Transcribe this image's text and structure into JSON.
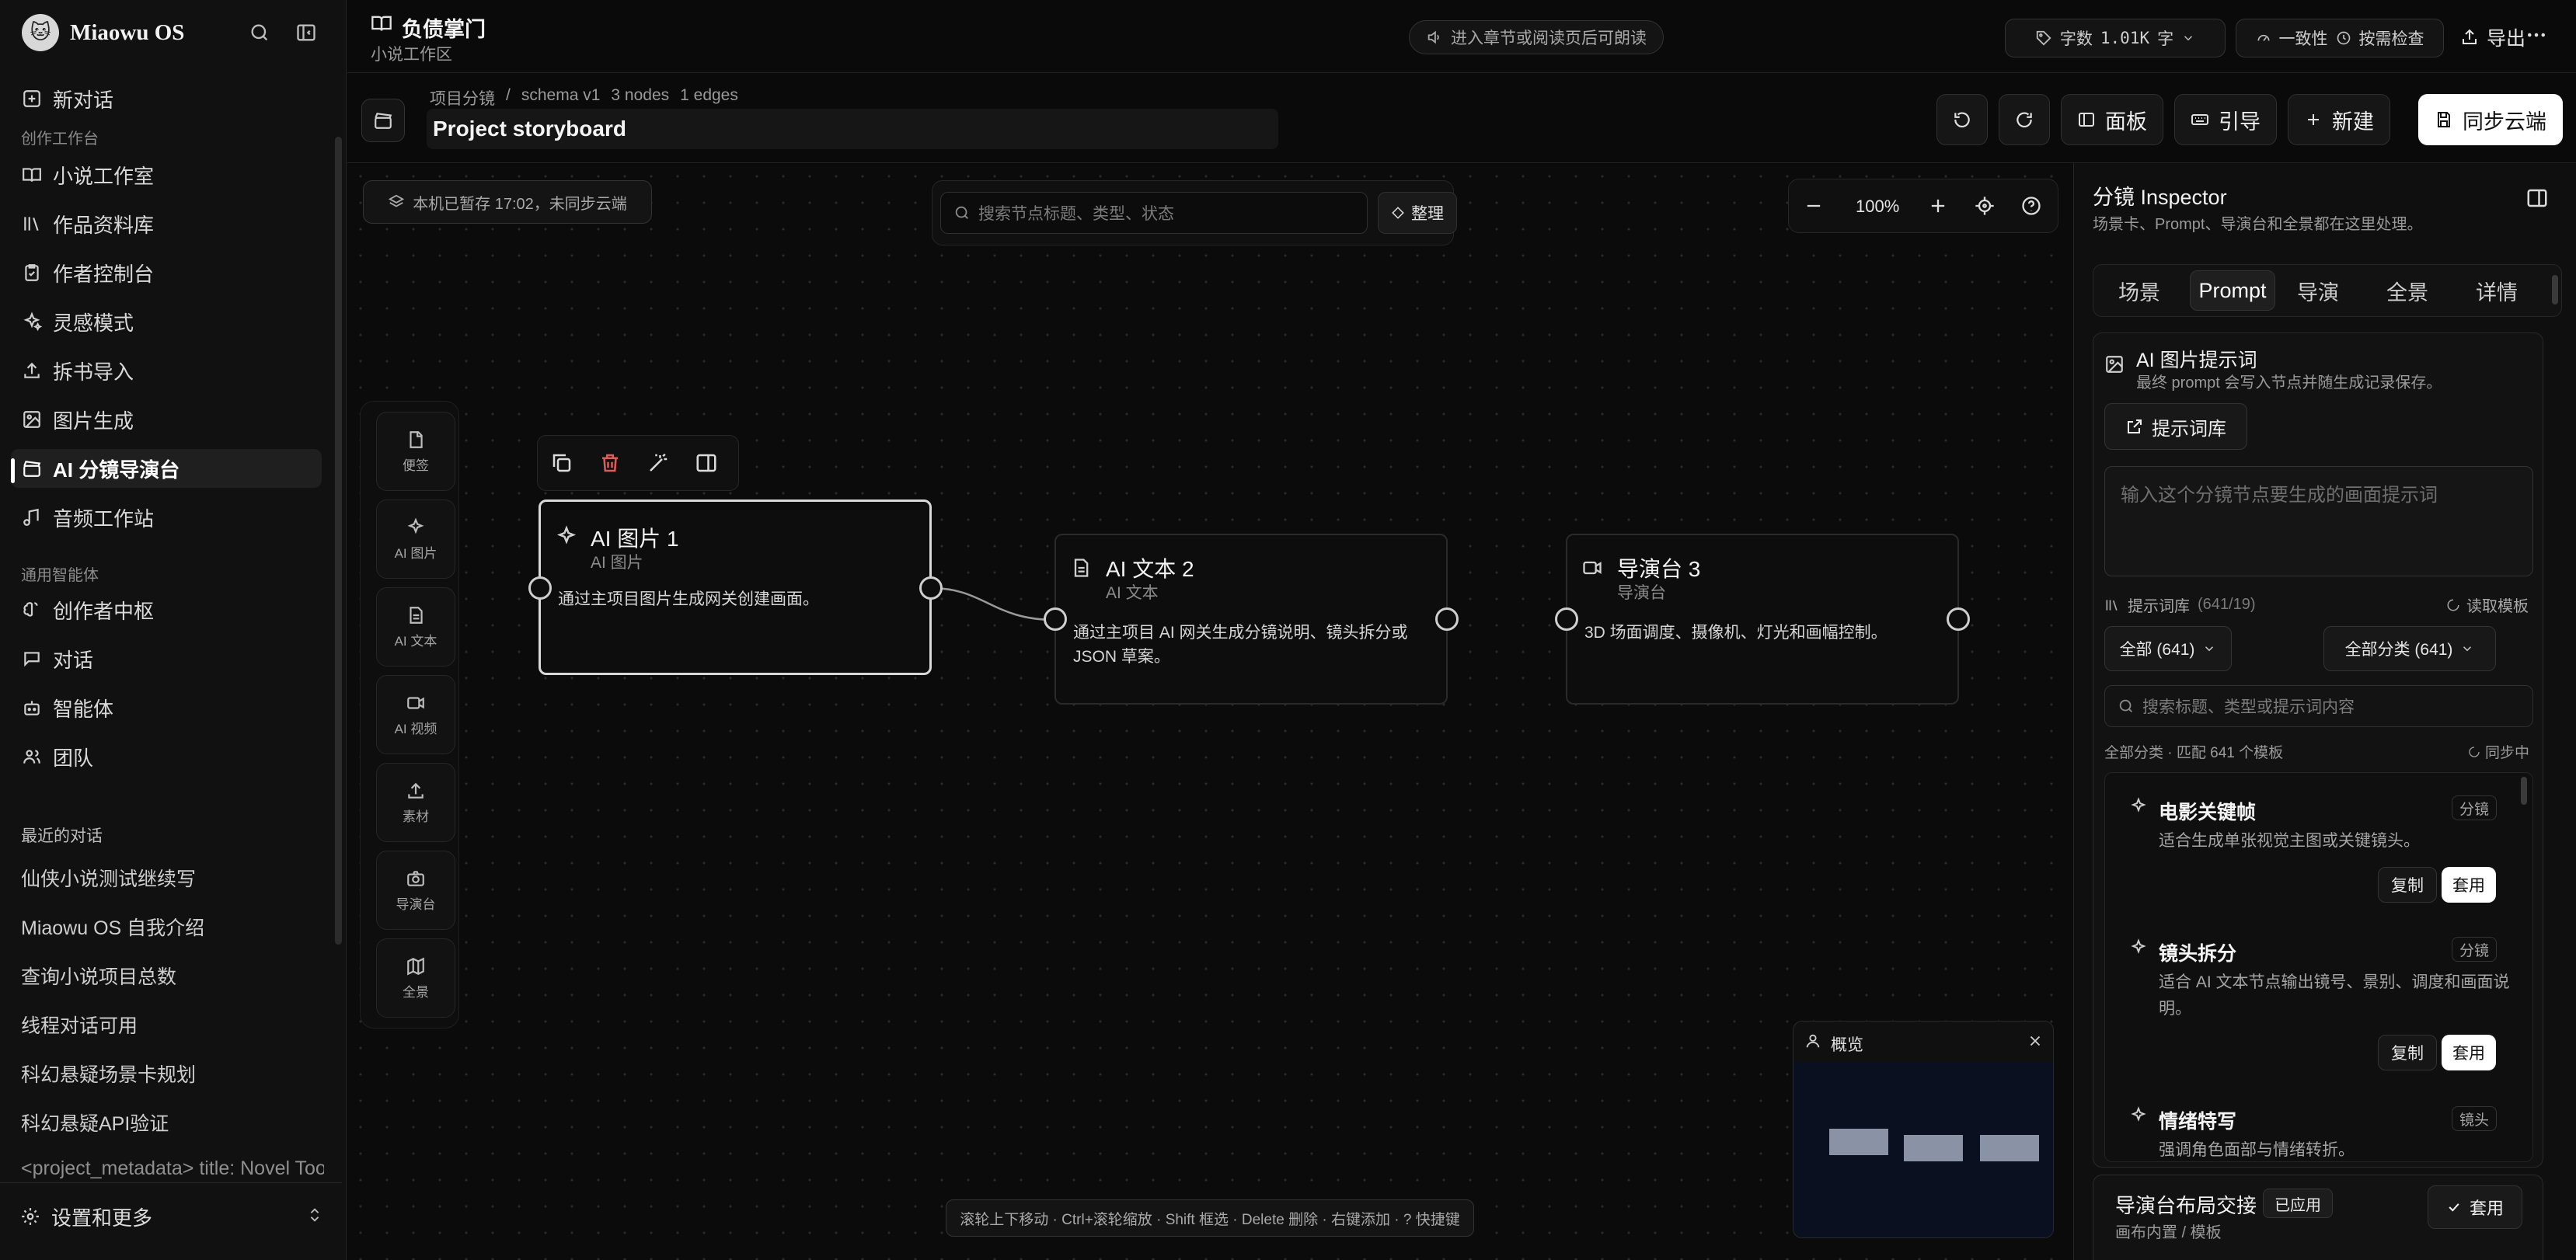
{
  "sidebar": {
    "brand": "Miaowu OS",
    "new_chat": "新对话",
    "section_workspace": "创作工作台",
    "items": [
      {
        "label": "小说工作室"
      },
      {
        "label": "作品资料库"
      },
      {
        "label": "作者控制台"
      },
      {
        "label": "灵感模式"
      },
      {
        "label": "拆书导入"
      },
      {
        "label": "图片生成"
      },
      {
        "label": "AI 分镜导演台"
      },
      {
        "label": "音频工作站"
      }
    ],
    "section_general": "通用智能体",
    "general_items": [
      {
        "label": "创作者中枢"
      },
      {
        "label": "对话"
      },
      {
        "label": "智能体"
      },
      {
        "label": "团队"
      }
    ],
    "section_recent": "最近的对话",
    "recent": [
      "仙侠小说测试继续写",
      "Miaowu OS 自我介绍",
      "查询小说项目总数",
      "线程对话可用",
      "科幻悬疑场景卡规划",
      "科幻悬疑API验证",
      "<project_metadata> title: Novel Tool"
    ],
    "settings": "设置和更多"
  },
  "header": {
    "title": "负债掌门",
    "subtitle": "小说工作区",
    "read_hint": "进入章节或阅读页后可朗读",
    "word_count_label": "字数",
    "word_count_value": "1.01K",
    "word_unit": "字",
    "consistency": "一致性",
    "check_on_demand": "按需检查",
    "export": "导出"
  },
  "subheader": {
    "breadcrumb_root": "项目分镜",
    "breadcrumb_sep": "/",
    "schema": "schema v1",
    "nodes": "3 nodes",
    "edges": "1 edges",
    "board_title": "Project storyboard",
    "panel_btn": "面板",
    "guide_btn": "引导",
    "new_btn": "新建",
    "sync_btn": "同步云端"
  },
  "canvas": {
    "save_status": "本机已暂存 17:02，未同步云端",
    "search_placeholder": "搜索节点标题、类型、状态",
    "arrange": "整理",
    "zoom": "100%",
    "tools": [
      "便签",
      "AI 图片",
      "AI 文本",
      "AI 视频",
      "素材",
      "导演台",
      "全景"
    ],
    "nodes": [
      {
        "title": "AI 图片 1",
        "type": "AI 图片",
        "desc": "通过主项目图片生成网关创建画面。"
      },
      {
        "title": "AI 文本 2",
        "type": "AI 文本",
        "desc": "通过主项目 AI 网关生成分镜说明、镜头拆分或 JSON 草案。"
      },
      {
        "title": "导演台 3",
        "type": "导演台",
        "desc": "3D 场面调度、摄像机、灯光和画幅控制。"
      }
    ],
    "minimap_title": "概览",
    "hint": "滚轮上下移动 · Ctrl+滚轮缩放 · Shift 框选 · Delete 删除 · 右键添加 · ? 快捷键"
  },
  "inspector": {
    "title": "分镜 Inspector",
    "subtitle": "场景卡、Prompt、导演台和全景都在这里处理。",
    "tabs": [
      "场景",
      "Prompt",
      "导演",
      "全景",
      "详情"
    ],
    "prompt_title": "AI 图片提示词",
    "prompt_sub": "最终 prompt 会写入节点并随生成记录保存。",
    "library_btn": "提示词库",
    "prompt_placeholder": "输入这个分镜节点要生成的画面提示词",
    "library_label": "提示词库",
    "library_count": "(641/19)",
    "read_template": "读取模板",
    "filter_all": "全部 (641)",
    "filter_category": "全部分类 (641)",
    "search_placeholder": "搜索标题、类型或提示词内容",
    "match_info": "全部分类 · 匹配 641 个模板",
    "syncing": "同步中",
    "templates": [
      {
        "title": "电影关键帧",
        "tag": "分镜",
        "desc": "适合生成单张视觉主图或关键镜头。",
        "copy": "复制",
        "apply": "套用"
      },
      {
        "title": "镜头拆分",
        "tag": "分镜",
        "desc": "适合 AI 文本节点输出镜号、景别、调度和画面说明。",
        "copy": "复制",
        "apply": "套用"
      },
      {
        "title": "情绪特写",
        "tag": "镜头",
        "desc": "强调角色面部与情绪转折。"
      }
    ],
    "footer_title": "导演台布局交接",
    "footer_badge": "已应用",
    "footer_sub": "画布内置 / 模板",
    "footer_apply": "套用"
  }
}
